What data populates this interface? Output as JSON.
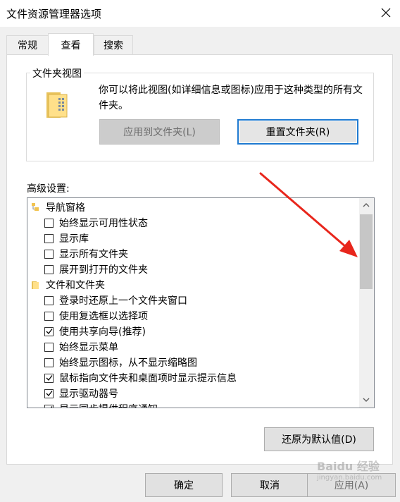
{
  "window": {
    "title": "文件资源管理器选项"
  },
  "tabs": [
    {
      "label": "常规"
    },
    {
      "label": "查看",
      "active": true
    },
    {
      "label": "搜索"
    }
  ],
  "folder_view": {
    "legend": "文件夹视图",
    "description": "你可以将此视图(如详细信息或图标)应用于这种类型的所有文件夹。",
    "apply_button": "应用到文件夹(L)",
    "reset_button": "重置文件夹(R)"
  },
  "advanced": {
    "label": "高级设置:",
    "items": [
      {
        "type": "category",
        "icon": "navigation-pane-icon",
        "label": "导航窗格"
      },
      {
        "type": "checkbox",
        "checked": false,
        "label": "始终显示可用性状态"
      },
      {
        "type": "checkbox",
        "checked": false,
        "label": "显示库"
      },
      {
        "type": "checkbox",
        "checked": false,
        "label": "显示所有文件夹"
      },
      {
        "type": "checkbox",
        "checked": false,
        "label": "展开到打开的文件夹"
      },
      {
        "type": "category",
        "icon": "folder-icon",
        "label": "文件和文件夹"
      },
      {
        "type": "checkbox",
        "checked": false,
        "label": "登录时还原上一个文件夹窗口"
      },
      {
        "type": "checkbox",
        "checked": false,
        "label": "使用复选框以选择项"
      },
      {
        "type": "checkbox",
        "checked": true,
        "label": "使用共享向导(推荐)"
      },
      {
        "type": "checkbox",
        "checked": false,
        "label": "始终显示菜单"
      },
      {
        "type": "checkbox",
        "checked": false,
        "label": "始终显示图标，从不显示缩略图"
      },
      {
        "type": "checkbox",
        "checked": true,
        "label": "鼠标指向文件夹和桌面项时显示提示信息"
      },
      {
        "type": "checkbox",
        "checked": true,
        "label": "显示驱动器号"
      },
      {
        "type": "checkbox",
        "checked": true,
        "label": "显示同步提供程序通知"
      }
    ]
  },
  "buttons": {
    "restore_defaults": "还原为默认值(D)",
    "ok": "确定",
    "cancel": "取消",
    "apply": "应用(A)"
  },
  "watermark": {
    "text": "Baidu 经验",
    "subtext": "jingyan.baidu.com"
  },
  "colors": {
    "annotation_arrow": "#e8261c",
    "focus_border": "#1f7ad1"
  }
}
